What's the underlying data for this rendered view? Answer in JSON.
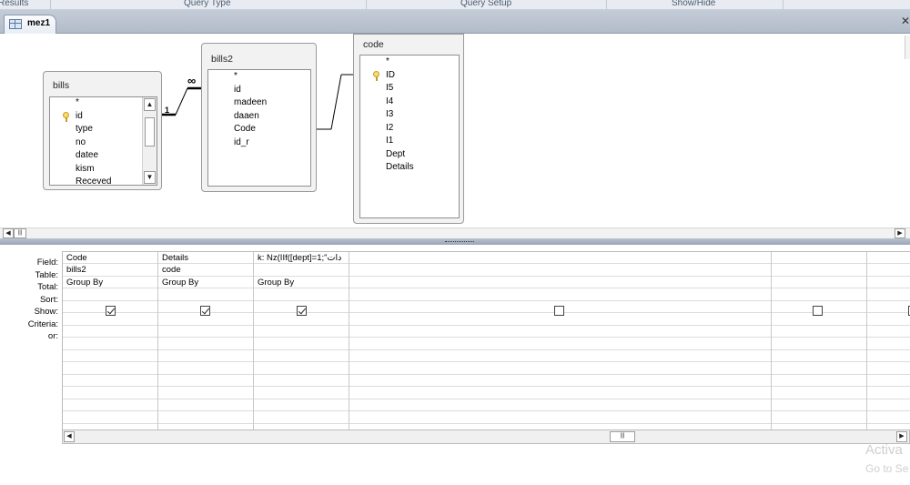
{
  "ribbon": {
    "groups": [
      "Results",
      "Query Type",
      "Query Setup",
      "Show/Hide"
    ]
  },
  "document_tab": {
    "label": "mez1",
    "icon": "query-icon"
  },
  "tables": {
    "bills": {
      "title": "bills",
      "fields": [
        "*",
        "id",
        "type",
        "no",
        "datee",
        "kism",
        "Receved"
      ],
      "primary_key": "id"
    },
    "bills2": {
      "title": "bills2",
      "fields": [
        "*",
        "id",
        "madeen",
        "daaen",
        "Code",
        "id_r"
      ]
    },
    "code": {
      "title": "code",
      "fields": [
        "*",
        "ID",
        "I5",
        "I4",
        "I3",
        "I2",
        "I1",
        "Dept",
        "Details"
      ],
      "primary_key": "ID"
    }
  },
  "relationships": [
    {
      "from": "bills.id",
      "to": "bills2.id_r",
      "from_label": "1",
      "to_label": "∞"
    },
    {
      "from": "bills2.Code",
      "to": "code.ID"
    }
  ],
  "grid": {
    "row_labels": [
      "Field:",
      "Table:",
      "Total:",
      "Sort:",
      "Show:",
      "Criteria:",
      "or:"
    ],
    "columns": [
      {
        "field": "Code",
        "table": "bills2",
        "total": "Group By",
        "sort": "",
        "show": true
      },
      {
        "field": "Details",
        "table": "code",
        "total": "Group By",
        "sort": "",
        "show": true
      },
      {
        "field": "k: Nz(IIf([dept]=1;\"دات",
        "table": "",
        "total": "Group By",
        "sort": "",
        "show": true
      },
      {
        "field": "",
        "table": "",
        "total": "",
        "sort": "",
        "show": false
      },
      {
        "field": "",
        "table": "",
        "total": "",
        "sort": "",
        "show": false
      },
      {
        "field": "",
        "table": "",
        "total": "",
        "sort": "",
        "show": false
      }
    ]
  },
  "watermark": {
    "line1": "Activa",
    "line2": "Go to Se"
  }
}
